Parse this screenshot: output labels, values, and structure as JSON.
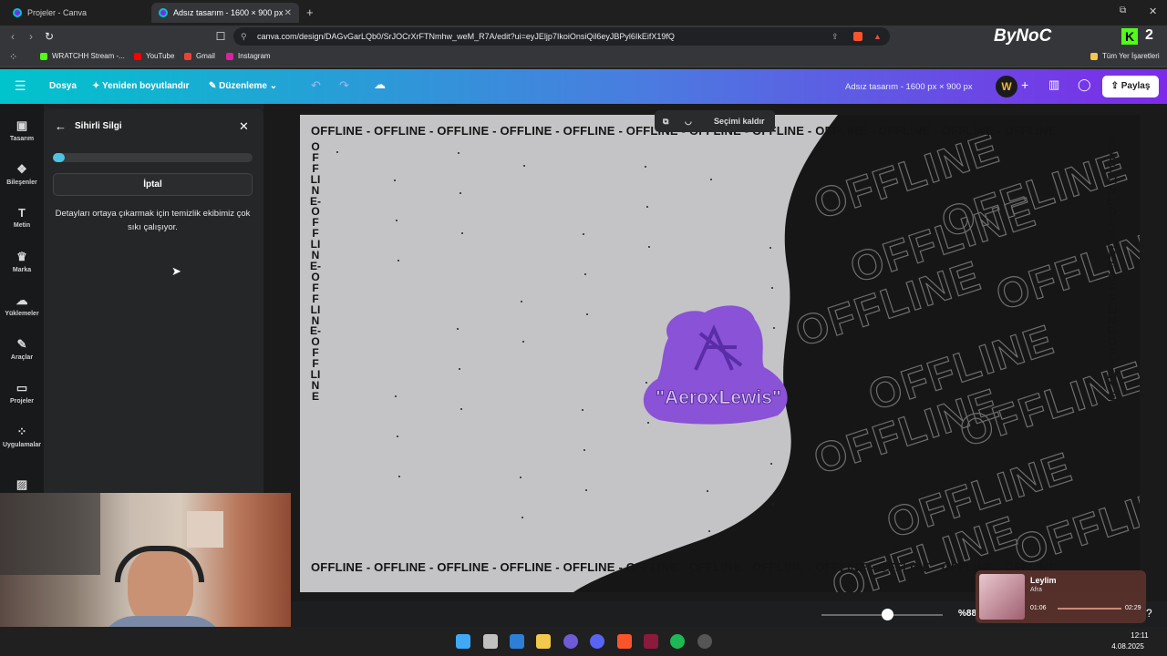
{
  "browser": {
    "tabs": [
      {
        "label": "Projeler - Canva",
        "active": false
      },
      {
        "label": "Adsız tasarım - 1600 × 900 px",
        "active": true
      }
    ],
    "url": "canva.com/design/DAGvGarLQb0/SrJOCrXrFTNmhw_weM_R7A/edit?ui=eyJEljp7IkoiOnsiQil6eyJBPyl6IkEifX19fQ",
    "bookmarks": [
      "WRATCHH Stream -...",
      "YouTube",
      "Gmail",
      "Instagram"
    ],
    "bookmarks_right": "Tüm Yer İşaretleri",
    "overlay_logo": "ByNoC"
  },
  "header": {
    "file": "Dosya",
    "resize": "Yeniden boyutlandır",
    "edit": "Düzenleme",
    "doc_title": "Adsız tasarım - 1600 px × 900 px",
    "share": "Paylaş"
  },
  "rail": {
    "items": [
      {
        "label": "Tasarım",
        "icon": "layout-icon",
        "glyph": "▣"
      },
      {
        "label": "Bileşenler",
        "icon": "elements-icon",
        "glyph": "❖"
      },
      {
        "label": "Metin",
        "icon": "text-icon",
        "glyph": "T"
      },
      {
        "label": "Marka",
        "icon": "brand-icon",
        "glyph": "♛"
      },
      {
        "label": "Yüklemeler",
        "icon": "upload-icon",
        "glyph": "☁"
      },
      {
        "label": "Araçlar",
        "icon": "draw-icon",
        "glyph": "✎"
      },
      {
        "label": "Projeler",
        "icon": "folder-icon",
        "glyph": "▭"
      },
      {
        "label": "Uygulamalar",
        "icon": "apps-icon",
        "glyph": "⁘"
      }
    ]
  },
  "panel": {
    "title": "Sihirli Silgi",
    "progress": 0.06,
    "cancel": "İptal",
    "message": "Detayları ortaya çıkarmak için temizlik ekibimiz çok sıkı çalışıyor."
  },
  "canvas": {
    "selection_toolbar": "Seçimi kaldır",
    "row_text": "OFFLINE - OFFLINE - OFFLINE - OFFLINE - OFFLINE - OFFLINE - OFFLINE - OFFLINE - OFFLINE - OFFLINE - OFFLINE - OFFLINE",
    "col_text": "OFFLINE-OFFLINE-OFFLINE-OFFLINE",
    "bg_word": "OFFLINE",
    "logo_text": "\"AeroxLewis\"",
    "colors": {
      "light": "#c4c4c6",
      "dark": "#161617",
      "logo": "#8a52d6"
    }
  },
  "footer": {
    "zoom": "%88",
    "zoom_level": 0.5
  },
  "music": {
    "title": "Leylim",
    "artist": "Afra",
    "elapsed": "01:06",
    "total": "02:29"
  },
  "taskbar": {
    "time": "12:11",
    "date": "4.08.2025"
  }
}
